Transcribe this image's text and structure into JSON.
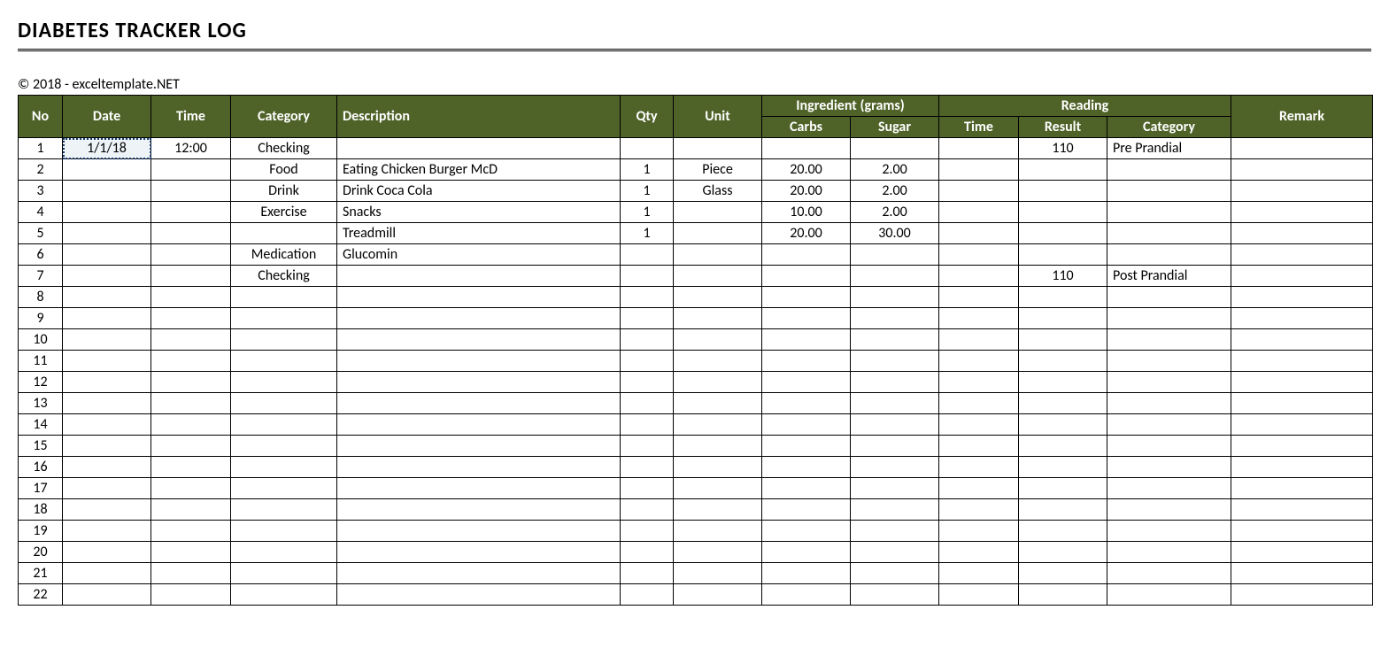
{
  "title": "DIABETES TRACKER  LOG",
  "copyright": "© 2018 - exceltemplate.NET",
  "headers": {
    "no": "No",
    "date": "Date",
    "time": "Time",
    "category": "Category",
    "description": "Description",
    "qty": "Qty",
    "unit": "Unit",
    "ingredient": "Ingredient (grams)",
    "carbs": "Carbs",
    "sugar": "Sugar",
    "reading": "Reading",
    "rtime": "Time",
    "result": "Result",
    "rcategory": "Category",
    "remark": "Remark"
  },
  "rows": [
    {
      "no": "1",
      "date": "1/1/18",
      "time": "12:00",
      "category": "Checking",
      "description": "",
      "qty": "",
      "unit": "",
      "carbs": "",
      "sugar": "",
      "rtime": "",
      "result": "110",
      "rcategory": "Pre Prandial",
      "remark": ""
    },
    {
      "no": "2",
      "date": "",
      "time": "",
      "category": "Food",
      "description": "Eating Chicken Burger McD",
      "qty": "1",
      "unit": "Piece",
      "carbs": "20.00",
      "sugar": "2.00",
      "rtime": "",
      "result": "",
      "rcategory": "",
      "remark": ""
    },
    {
      "no": "3",
      "date": "",
      "time": "",
      "category": "Drink",
      "description": "Drink Coca Cola",
      "qty": "1",
      "unit": "Glass",
      "carbs": "20.00",
      "sugar": "2.00",
      "rtime": "",
      "result": "",
      "rcategory": "",
      "remark": ""
    },
    {
      "no": "4",
      "date": "",
      "time": "",
      "category": "Exercise",
      "description": "Snacks",
      "qty": "1",
      "unit": "",
      "carbs": "10.00",
      "sugar": "2.00",
      "rtime": "",
      "result": "",
      "rcategory": "",
      "remark": ""
    },
    {
      "no": "5",
      "date": "",
      "time": "",
      "category": "",
      "description": "Treadmill",
      "qty": "1",
      "unit": "",
      "carbs": "20.00",
      "sugar": "30.00",
      "rtime": "",
      "result": "",
      "rcategory": "",
      "remark": ""
    },
    {
      "no": "6",
      "date": "",
      "time": "",
      "category": "Medication",
      "description": "Glucomin",
      "qty": "",
      "unit": "",
      "carbs": "",
      "sugar": "",
      "rtime": "",
      "result": "",
      "rcategory": "",
      "remark": ""
    },
    {
      "no": "7",
      "date": "",
      "time": "",
      "category": "Checking",
      "description": "",
      "qty": "",
      "unit": "",
      "carbs": "",
      "sugar": "",
      "rtime": "",
      "result": "110",
      "rcategory": "Post Prandial",
      "remark": ""
    },
    {
      "no": "8"
    },
    {
      "no": "9"
    },
    {
      "no": "10"
    },
    {
      "no": "11"
    },
    {
      "no": "12"
    },
    {
      "no": "13"
    },
    {
      "no": "14"
    },
    {
      "no": "15"
    },
    {
      "no": "16"
    },
    {
      "no": "17"
    },
    {
      "no": "18"
    },
    {
      "no": "19"
    },
    {
      "no": "20"
    },
    {
      "no": "21"
    },
    {
      "no": "22"
    }
  ]
}
